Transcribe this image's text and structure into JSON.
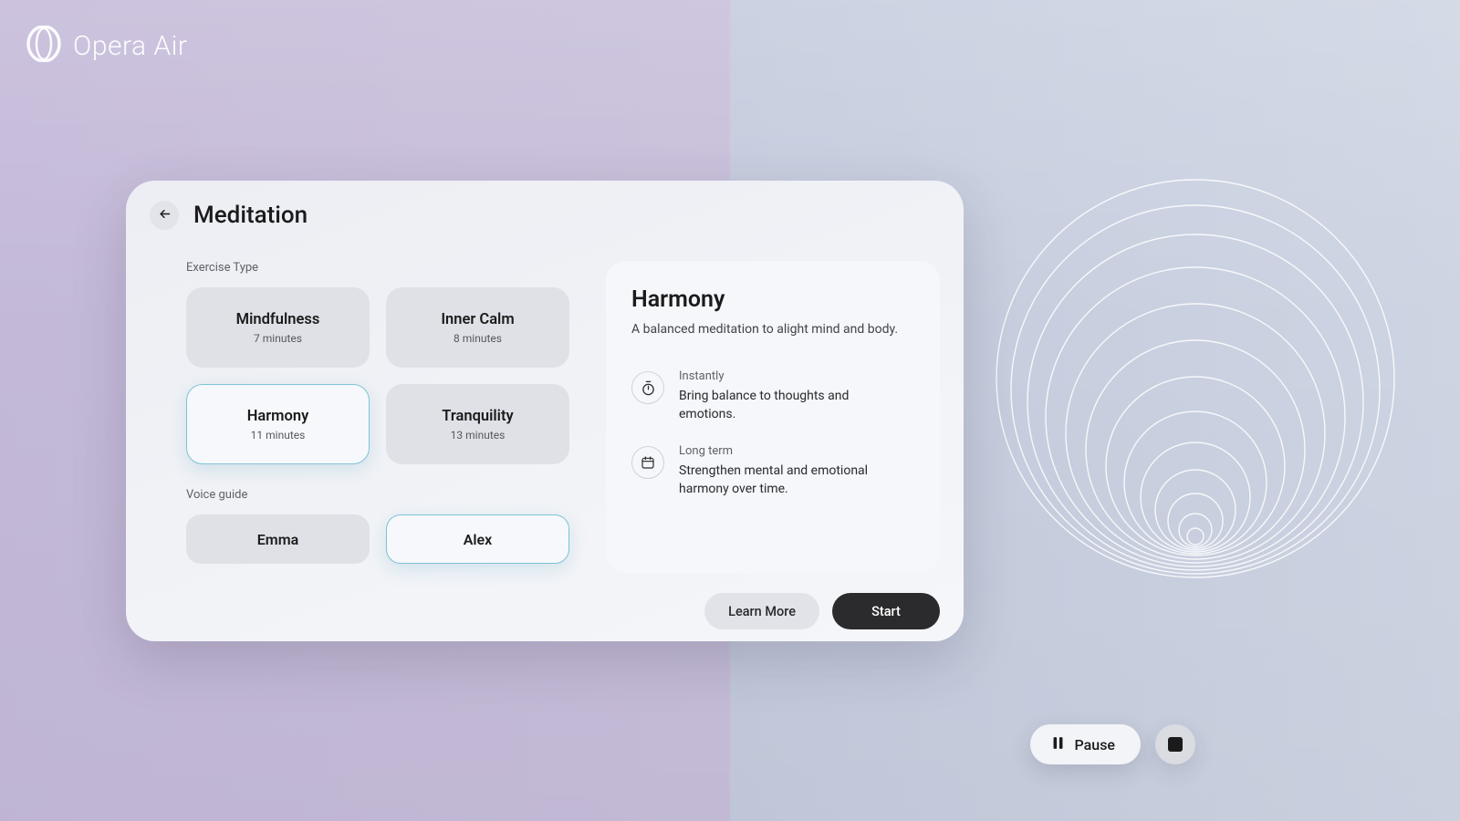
{
  "brand": {
    "name": "Opera Air"
  },
  "page": {
    "title": "Meditation"
  },
  "exercise": {
    "section_label": "Exercise Type",
    "types": [
      {
        "name": "Mindfulness",
        "duration": "7 minutes",
        "selected": false
      },
      {
        "name": "Inner Calm",
        "duration": "8 minutes",
        "selected": false
      },
      {
        "name": "Harmony",
        "duration": "11 minutes",
        "selected": true
      },
      {
        "name": "Tranquility",
        "duration": "13 minutes",
        "selected": false
      }
    ]
  },
  "voice": {
    "section_label": "Voice guide",
    "options": [
      {
        "name": "Emma",
        "selected": false
      },
      {
        "name": "Alex",
        "selected": true
      }
    ]
  },
  "detail": {
    "title": "Harmony",
    "subtitle": "A balanced meditation to alight mind and body.",
    "benefits": [
      {
        "label": "Instantly",
        "text": "Bring balance to thoughts and emotions.",
        "icon": "stopwatch"
      },
      {
        "label": "Long term",
        "text": "Strengthen mental and emotional harmony over time.",
        "icon": "calendar"
      }
    ]
  },
  "actions": {
    "learn_more": "Learn More",
    "start": "Start"
  },
  "controls": {
    "pause": "Pause"
  }
}
